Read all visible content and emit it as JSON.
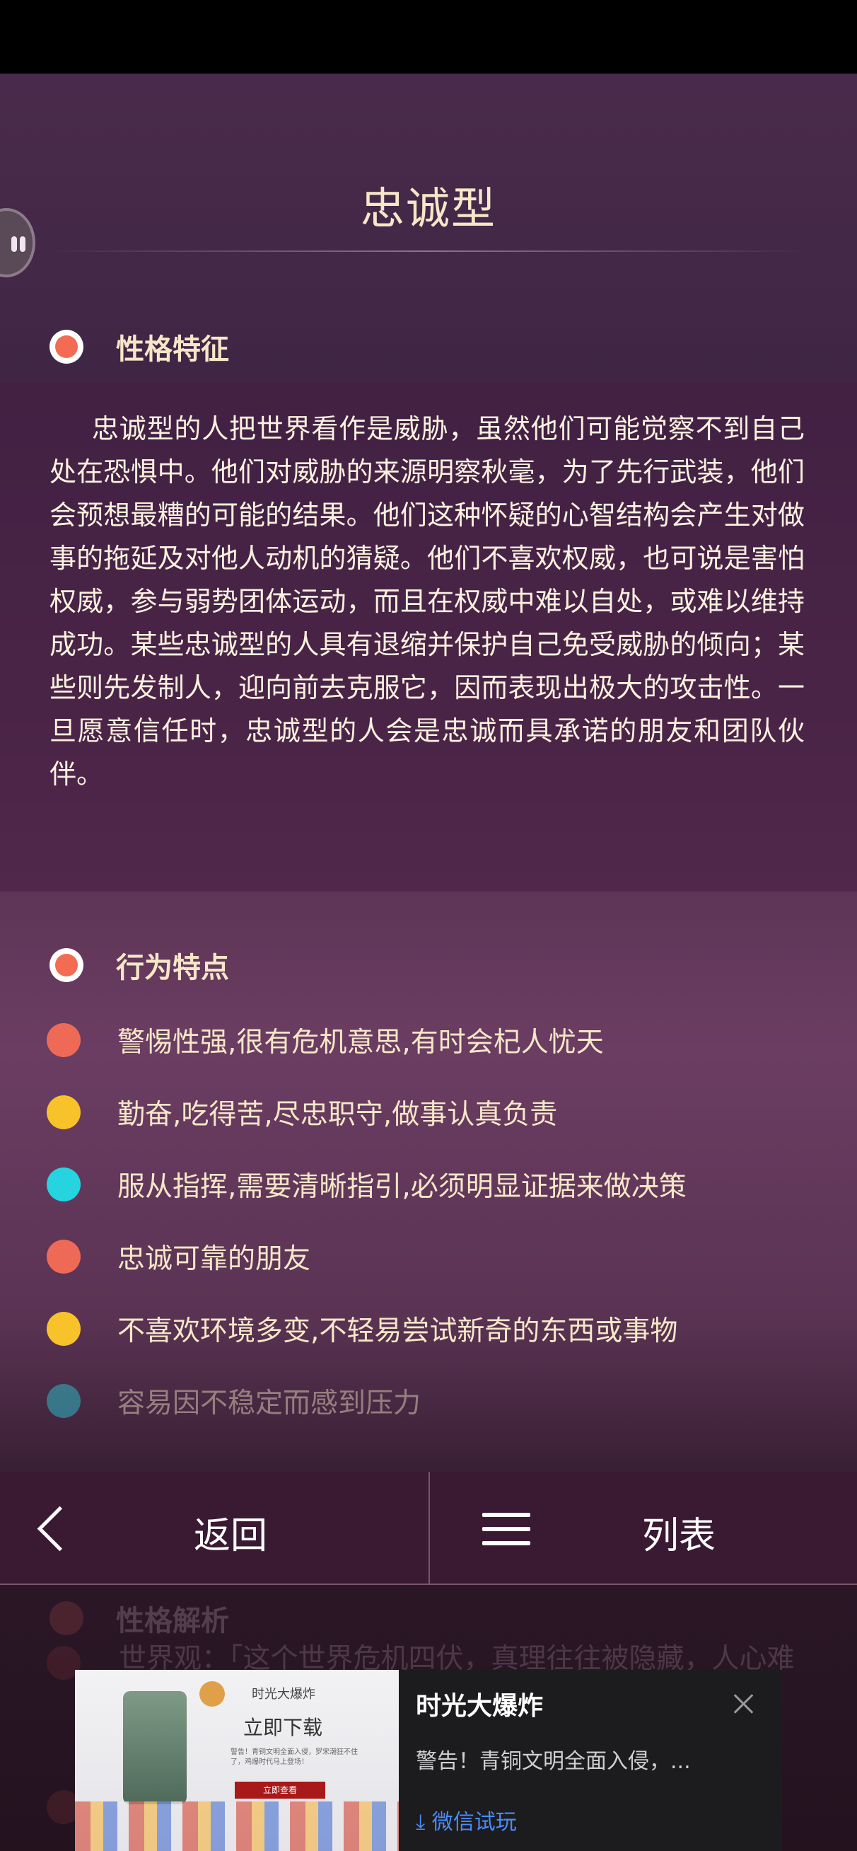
{
  "page": {
    "title": "忠诚型"
  },
  "personality": {
    "heading": "性格特征",
    "text": "忠诚型的人把世界看作是威胁，虽然他们可能觉察不到自己处在恐惧中。他们对威胁的来源明察秋毫，为了先行武装，他们会预想最糟的可能的结果。他们这种怀疑的心智结构会产生对做事的拖延及对他人动机的猜疑。他们不喜欢权威，也可说是害怕权威，参与弱势团体运动，而且在权威中难以自处，或难以维持成功。某些忠诚型的人具有退缩并保护自己免受威胁的倾向；某些则先发制人，迎向前去克服它，因而表现出极大的攻击性。一旦愿意信任时，忠诚型的人会是忠诚而具承诺的朋友和团队伙伴。"
  },
  "behavior": {
    "heading": "行为特点",
    "items": [
      {
        "text": "警惕性强,很有危机意思,有时会杞人忧天",
        "color": "#ee6a57"
      },
      {
        "text": "勤奋,吃得苦,尽忠职守,做事认真负责",
        "color": "#f7c22a"
      },
      {
        "text": "服从指挥,需要清晰指引,必须明显证据来做决策",
        "color": "#26d4e0"
      },
      {
        "text": "忠诚可靠的朋友",
        "color": "#ee6a57"
      },
      {
        "text": "不喜欢环境多变,不轻易尝试新奇的东西或事物",
        "color": "#f7c22a"
      },
      {
        "text": "容易因不稳定而感到压力",
        "color": "#26d4e0"
      }
    ]
  },
  "nav": {
    "back_label": "返回",
    "list_label": "列表"
  },
  "analysis": {
    "heading": "性格解析",
    "text": "世界观：「这个世界危机四伏，真理往往被隐藏，人心难测，遇人不慎，就会被人利用和陷害，我渴望能找到我信任的同道中人」"
  },
  "ad": {
    "title": "时光大爆炸",
    "description": "警告！青铜文明全面入侵，...",
    "cta": "微信试玩",
    "image_title": "时光大爆炸",
    "image_download": "立即下载",
    "image_warning": "警告！青铜文明全面入侵，罗宋潮狂不住了，鸡爆时代马上登场！",
    "image_button": "立即查看"
  }
}
